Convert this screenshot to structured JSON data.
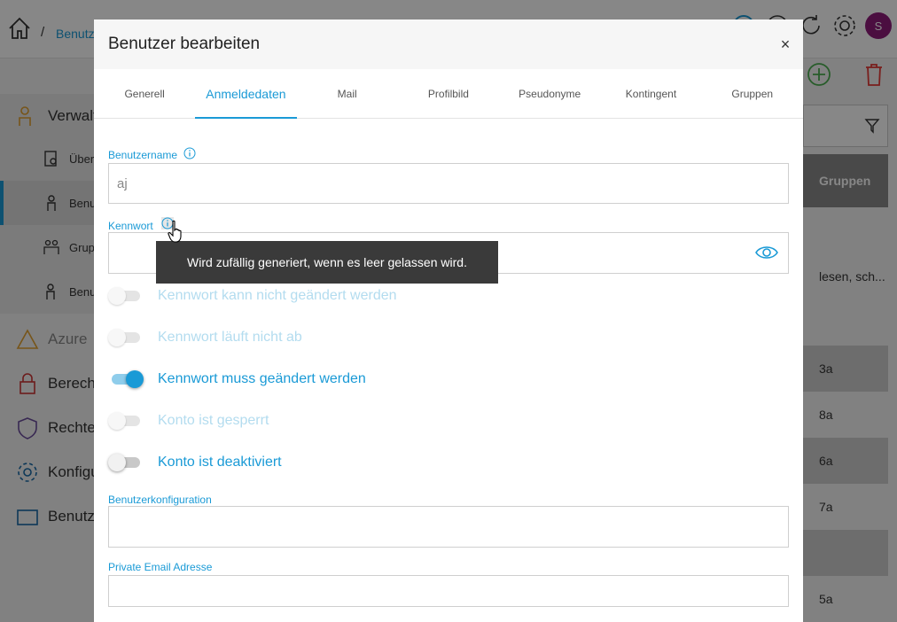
{
  "app": {
    "breadcrumb_sep": "/",
    "breadcrumb_link": "Benutz",
    "avatar_initial": "S",
    "sidebar": {
      "verwaltung": "Verwalt",
      "uebersicht": "Über",
      "benutzer": "Benu",
      "gruppen": "Grup",
      "benutzer2": "Benu",
      "azure": "Azure",
      "berechtigungen": "Berecht",
      "rechte": "Rechtev",
      "konfiguration": "Konfigu",
      "benutzerlog": "Benutz"
    },
    "table": {
      "header": "Gruppen",
      "rows": [
        "lesen, sch...",
        "3a",
        "8a",
        "6a",
        "7a",
        "5a"
      ]
    }
  },
  "modal": {
    "title": "Benutzer bearbeiten",
    "close_label": "×",
    "tabs": [
      "Generell",
      "Anmeldedaten",
      "Mail",
      "Profilbild",
      "Pseudonyme",
      "Kontingent",
      "Gruppen"
    ],
    "active_tab": 1,
    "username": {
      "label": "Benutzername",
      "value": "aj"
    },
    "password": {
      "label": "Kennwort",
      "value": ""
    },
    "tooltip": "Wird zufällig generiert, wenn es leer gelassen wird.",
    "toggles": [
      {
        "label": "Kennwort kann nicht geändert werden",
        "on": false,
        "disabled": true
      },
      {
        "label": "Kennwort läuft nicht ab",
        "on": false,
        "disabled": true
      },
      {
        "label": "Kennwort muss geändert werden",
        "on": true,
        "disabled": false
      },
      {
        "label": "Konto ist gesperrt",
        "on": false,
        "disabled": true
      },
      {
        "label": "Konto ist deaktiviert",
        "on": false,
        "disabled": false
      }
    ],
    "user_config": {
      "label": "Benutzerkonfiguration",
      "value": ""
    },
    "private_email": {
      "label": "Private Email Adresse",
      "value": ""
    }
  },
  "colors": {
    "accent": "#1a9ad6",
    "overlay": "rgba(0,0,0,0.47)",
    "avatar": "#8e1b7a"
  }
}
